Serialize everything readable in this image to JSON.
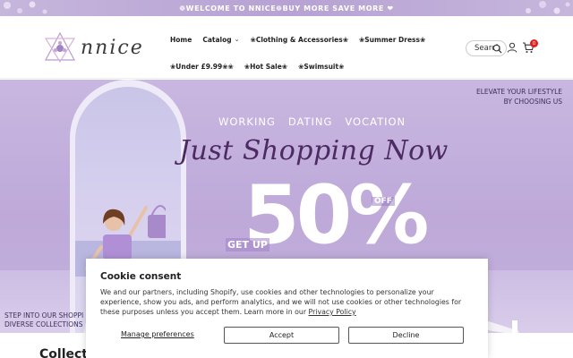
{
  "announcement": {
    "text": "❁WELCOME TO NNICE❁BUY MORE SAVE MORE ❤"
  },
  "header": {
    "logo_text": "nnice",
    "nav_row1": [
      {
        "label": "Home",
        "has_dropdown": false
      },
      {
        "label": "Catalog",
        "has_dropdown": true
      },
      {
        "label": "❀Clothing & Accessories❀",
        "has_dropdown": false
      },
      {
        "label": "❀Summer Dress❀",
        "has_dropdown": false
      }
    ],
    "nav_row2": [
      {
        "label": "❀Under £9.99❀❀",
        "has_dropdown": false
      },
      {
        "label": "❀Hot Sale❀",
        "has_dropdown": false
      },
      {
        "label": "❀Swimsuit❀",
        "has_dropdown": false
      }
    ],
    "search_placeholder": "Search",
    "cart_count": "0",
    "icons": [
      "search-icon",
      "user-icon",
      "cart-icon"
    ]
  },
  "hero": {
    "tagline_line1": "ELEVATE YOUR LIFESTYLE",
    "tagline_line2": "BY CHOOSING US",
    "themes": "WORKING   DATING   VOCATION",
    "title": "Just Shopping Now",
    "get_up": "GET UP",
    "discount": "50%",
    "off": "OFF",
    "step_line1": "STEP INTO OUR SHOPPI",
    "step_line2": "DIVERSE COLLECTIONS",
    "colors": {
      "background": "#c3b0dc",
      "title": "#4c2a63"
    }
  },
  "section": {
    "heading": "Collect"
  },
  "cookie": {
    "title": "Cookie consent",
    "body": "We and our partners, including Shopify, use cookies and other technologies to personalize your experience, show you ads, and perform analytics, and we will not use cookies or other technologies for these purposes unless you accept them. Learn more in our ",
    "policy_link": "Privacy Policy",
    "manage_label": "Manage preferences",
    "accept_label": "Accept",
    "decline_label": "Decline"
  }
}
